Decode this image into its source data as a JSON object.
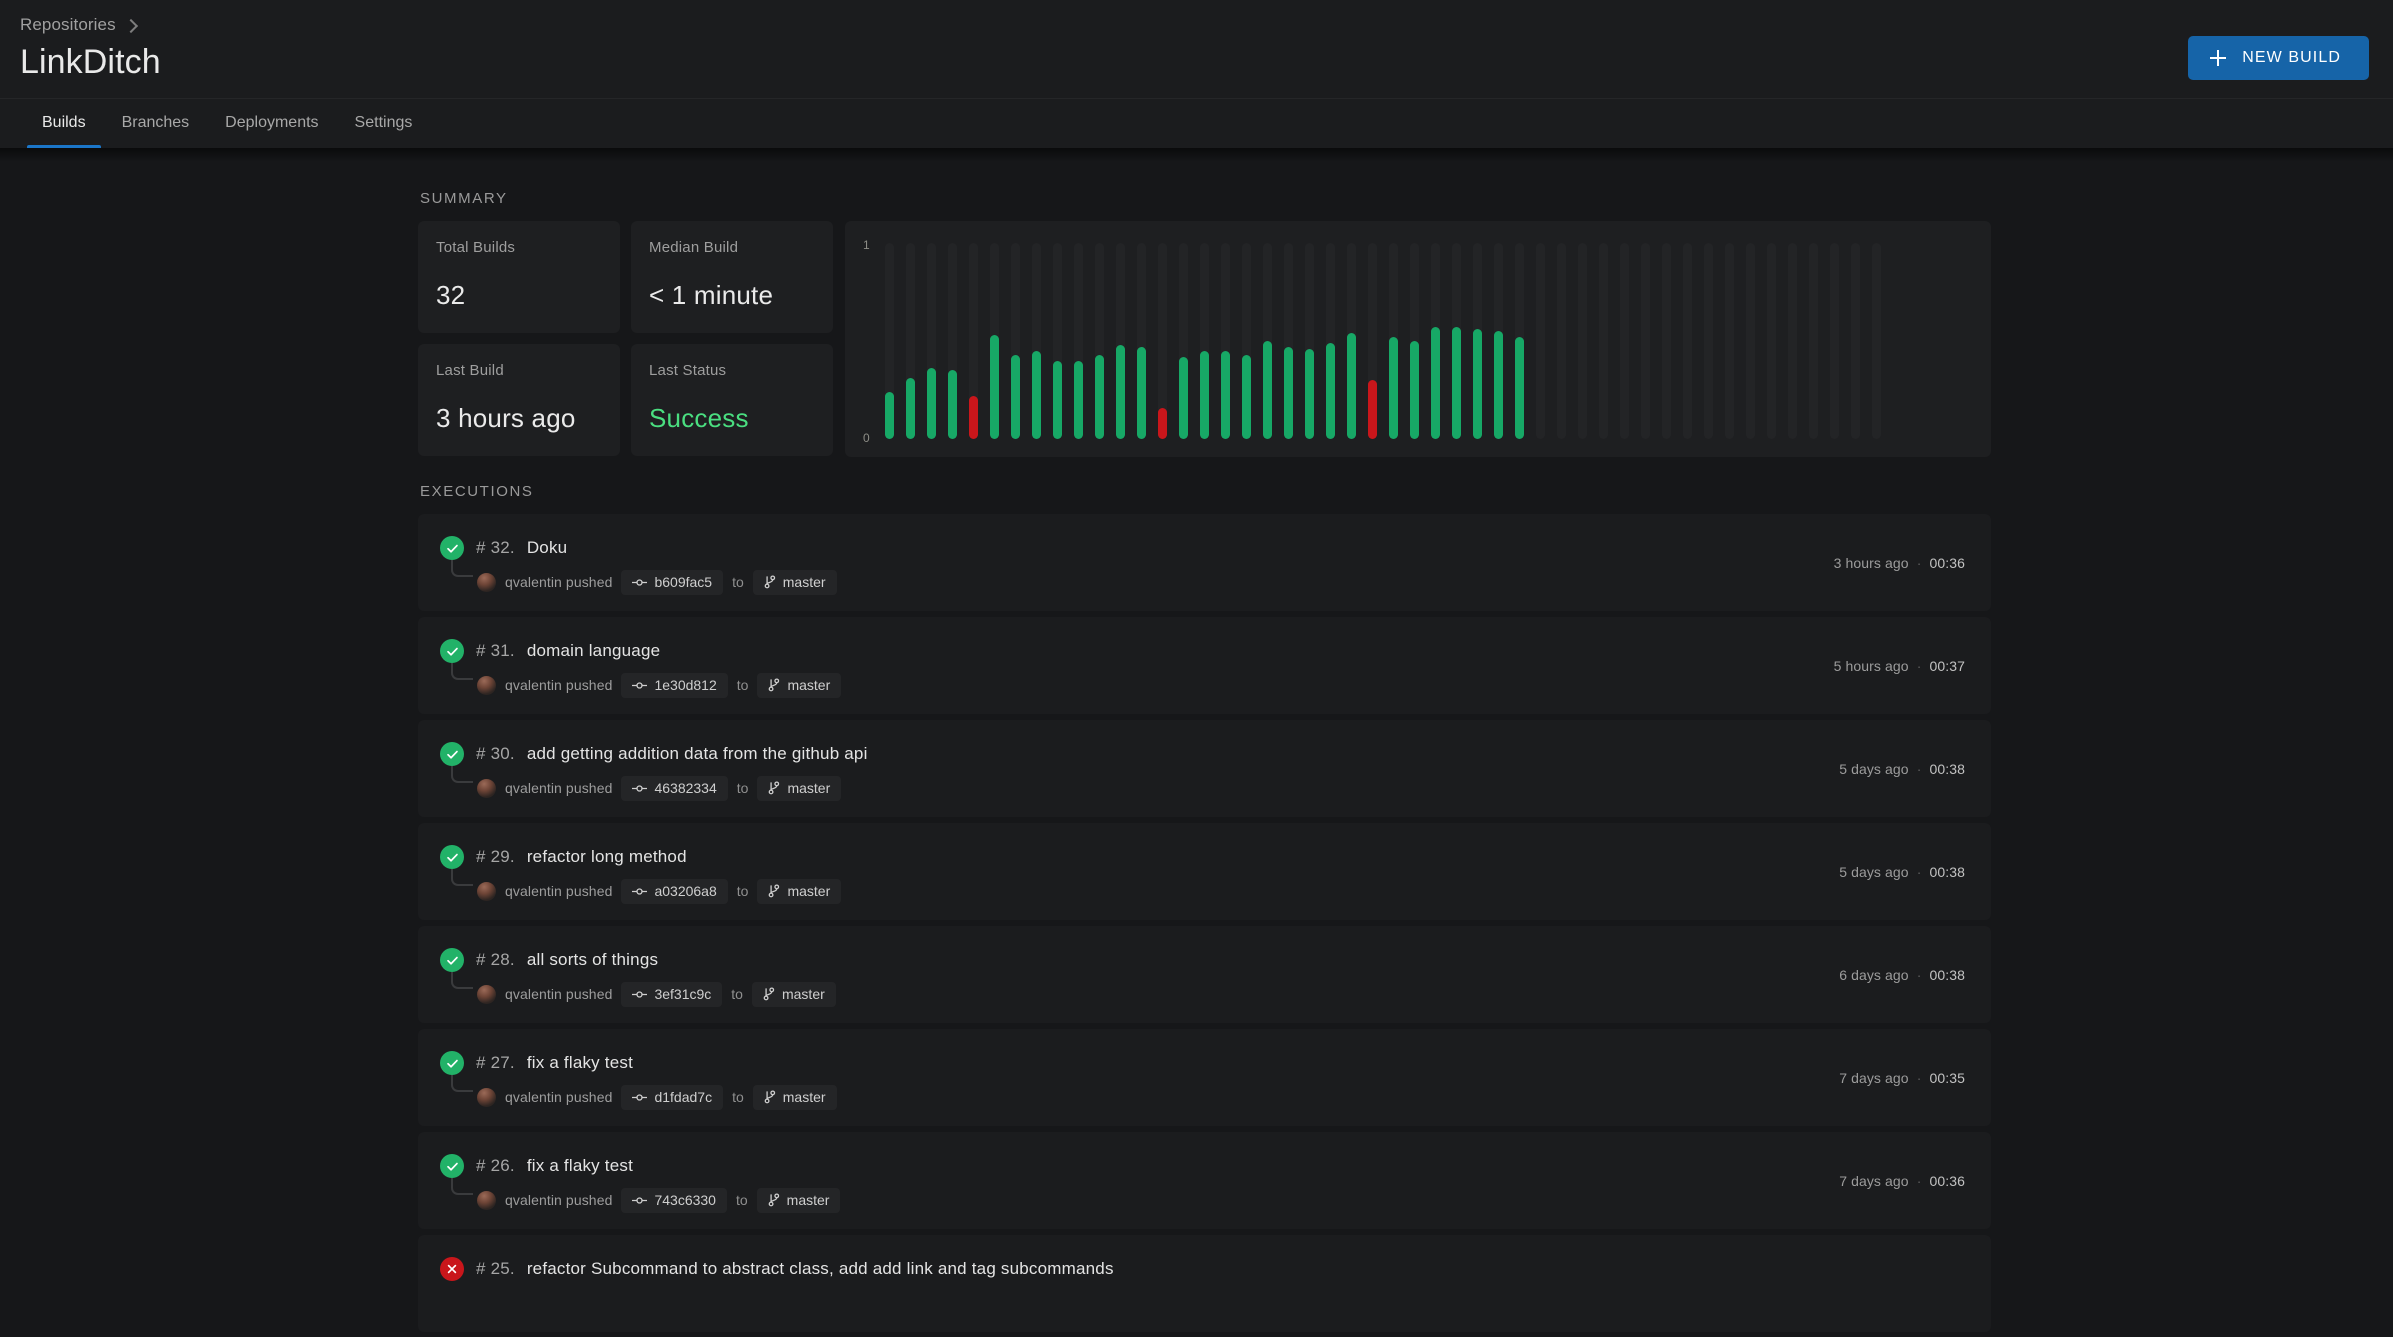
{
  "header": {
    "breadcrumb": "Repositories",
    "title": "LinkDitch",
    "new_build_label": "NEW BUILD"
  },
  "tabs": [
    {
      "label": "Builds",
      "active": true
    },
    {
      "label": "Branches",
      "active": false
    },
    {
      "label": "Deployments",
      "active": false
    },
    {
      "label": "Settings",
      "active": false
    }
  ],
  "summary": {
    "section_label": "SUMMARY",
    "stats": [
      {
        "label": "Total Builds",
        "value": "32",
        "accent": false
      },
      {
        "label": "Median Build",
        "value": "< 1 minute",
        "accent": false
      },
      {
        "label": "Last Build",
        "value": "3 hours ago",
        "accent": false
      },
      {
        "label": "Last Status",
        "value": "Success",
        "accent": true
      }
    ]
  },
  "chart_data": {
    "type": "bar",
    "title": "",
    "xlabel": "",
    "ylabel": "",
    "ylim": [
      0,
      1
    ],
    "yticks": [
      "0",
      "1"
    ],
    "grid": false,
    "legend": null,
    "colors": {
      "success": "#17a866",
      "failure": "#c9161b",
      "empty_track": "#232426"
    },
    "categories": [
      "1",
      "2",
      "3",
      "4",
      "5",
      "6",
      "7",
      "8",
      "9",
      "10",
      "11",
      "12",
      "13",
      "14",
      "15",
      "16",
      "17",
      "18",
      "19",
      "20",
      "21",
      "22",
      "23",
      "24",
      "25",
      "26",
      "27",
      "28",
      "29",
      "30",
      "31",
      "32",
      "33",
      "34",
      "35",
      "36",
      "37",
      "38",
      "39",
      "40",
      "41",
      "42",
      "43",
      "44",
      "45",
      "46",
      "47",
      "48"
    ],
    "values": [
      0.24,
      0.31,
      0.36,
      0.35,
      0.22,
      0.53,
      0.43,
      0.45,
      0.4,
      0.4,
      0.43,
      0.48,
      0.47,
      0.16,
      0.42,
      0.45,
      0.45,
      0.43,
      0.5,
      0.47,
      0.46,
      0.49,
      0.54,
      0.3,
      0.52,
      0.5,
      0.57,
      0.57,
      0.56,
      0.55,
      0.52,
      null,
      null,
      null,
      null,
      null,
      null,
      null,
      null,
      null,
      null,
      null,
      null,
      null,
      null,
      null,
      null,
      null
    ],
    "statuses": [
      "success",
      "success",
      "success",
      "success",
      "failure",
      "success",
      "success",
      "success",
      "success",
      "success",
      "success",
      "success",
      "success",
      "failure",
      "success",
      "success",
      "success",
      "success",
      "success",
      "success",
      "success",
      "success",
      "success",
      "failure",
      "success",
      "success",
      "success",
      "success",
      "success",
      "success",
      "success",
      "empty",
      "empty",
      "empty",
      "empty",
      "empty",
      "empty",
      "empty",
      "empty",
      "empty",
      "empty",
      "empty",
      "empty",
      "empty",
      "empty",
      "empty",
      "empty",
      "empty"
    ]
  },
  "executions": {
    "section_label": "EXECUTIONS",
    "to_word": "to",
    "separator": "·",
    "rows": [
      {
        "status": "success",
        "number": "# 32.",
        "title": "Doku",
        "pusher": "qvalentin pushed",
        "commit": "b609fac5",
        "branch": "master",
        "time": "3 hours ago",
        "duration": "00:36"
      },
      {
        "status": "success",
        "number": "# 31.",
        "title": "domain language",
        "pusher": "qvalentin pushed",
        "commit": "1e30d812",
        "branch": "master",
        "time": "5 hours ago",
        "duration": "00:37"
      },
      {
        "status": "success",
        "number": "# 30.",
        "title": "add getting addition data from the github api",
        "pusher": "qvalentin pushed",
        "commit": "46382334",
        "branch": "master",
        "time": "5 days ago",
        "duration": "00:38"
      },
      {
        "status": "success",
        "number": "# 29.",
        "title": "refactor long method",
        "pusher": "qvalentin pushed",
        "commit": "a03206a8",
        "branch": "master",
        "time": "5 days ago",
        "duration": "00:38"
      },
      {
        "status": "success",
        "number": "# 28.",
        "title": "all sorts of things",
        "pusher": "qvalentin pushed",
        "commit": "3ef31c9c",
        "branch": "master",
        "time": "6 days ago",
        "duration": "00:38"
      },
      {
        "status": "success",
        "number": "# 27.",
        "title": "fix a flaky test",
        "pusher": "qvalentin pushed",
        "commit": "d1fdad7c",
        "branch": "master",
        "time": "7 days ago",
        "duration": "00:35"
      },
      {
        "status": "success",
        "number": "# 26.",
        "title": "fix a flaky test",
        "pusher": "qvalentin pushed",
        "commit": "743c6330",
        "branch": "master",
        "time": "7 days ago",
        "duration": "00:36"
      },
      {
        "status": "failure",
        "number": "# 25.",
        "title": "refactor Subcommand to abstract class, add add link and tag subcommands",
        "pusher": "",
        "commit": "",
        "branch": "",
        "time": "",
        "duration": ""
      }
    ]
  }
}
